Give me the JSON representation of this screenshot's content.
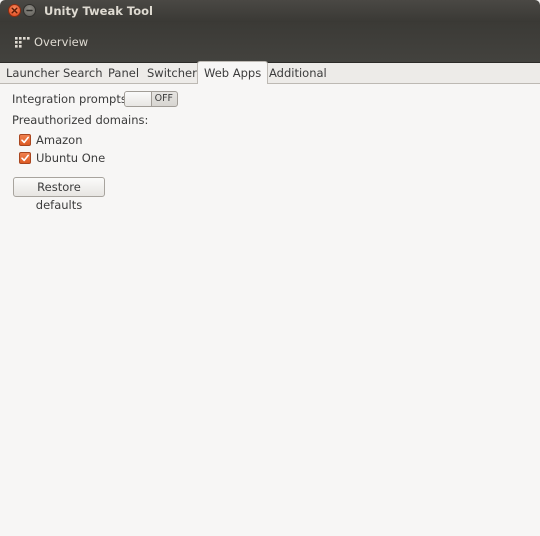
{
  "window": {
    "title": "Unity Tweak Tool"
  },
  "toolbar": {
    "overview_label": "Overview"
  },
  "tabs": [
    {
      "label": "Launcher",
      "active": false
    },
    {
      "label": "Search",
      "active": false
    },
    {
      "label": "Panel",
      "active": false
    },
    {
      "label": "Switcher",
      "active": false
    },
    {
      "label": "Web Apps",
      "active": true
    },
    {
      "label": "Additional",
      "active": false
    }
  ],
  "webapps": {
    "integration_label": "Integration prompts:",
    "integration_state": "OFF",
    "preauthorized_label": "Preauthorized domains:",
    "domains": [
      {
        "label": "Amazon",
        "checked": true
      },
      {
        "label": "Ubuntu One",
        "checked": true
      }
    ],
    "restore_label": "Restore defaults"
  },
  "colors": {
    "accent": "#dd5a23",
    "titlebar": "#3c3b37",
    "background": "#f2f1f0"
  }
}
